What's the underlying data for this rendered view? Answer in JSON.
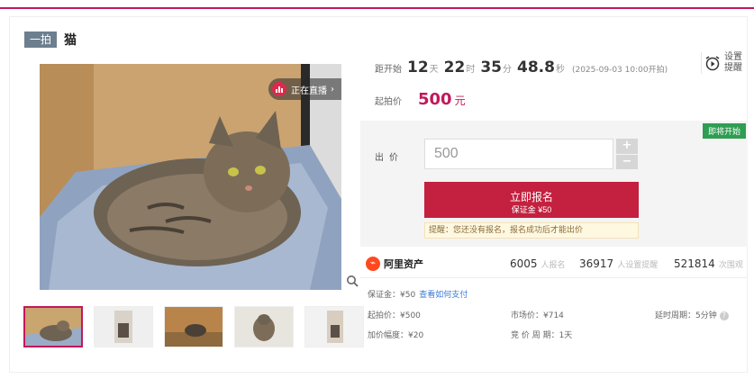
{
  "header": {
    "tag": "一拍",
    "title": "猫"
  },
  "live": {
    "label": "正在直播"
  },
  "countdown": {
    "label": "距开始",
    "days": "12",
    "days_unit": "天",
    "hours": "22",
    "hours_unit": "时",
    "minutes": "35",
    "minutes_unit": "分",
    "seconds": "48.8",
    "seconds_unit": "秒",
    "start_date": "(2025-09-03 10:00开拍)"
  },
  "remind": {
    "label": "设置提醒"
  },
  "start_price": {
    "label": "起拍价",
    "value": "500",
    "unit": "元"
  },
  "bid": {
    "coming_badge": "即将开始",
    "label": "出价",
    "input_value": "500",
    "plus": "+",
    "minus": "−",
    "signup_label": "立即报名",
    "deposit_label": "保证金 ¥50",
    "hint": "提醒：您还没有报名，报名成功后才能出价"
  },
  "org": {
    "name": "阿里资产",
    "stats": [
      {
        "value": "6005",
        "label": "人报名"
      },
      {
        "value": "36917",
        "label": "人设置提醒"
      },
      {
        "value": "521814",
        "label": "次围观"
      }
    ]
  },
  "details": {
    "deposit": "保证金：¥50",
    "how_to_pay": "查看如何支付",
    "start_price": "起拍价：¥500",
    "market_price": "市场价：¥714",
    "cycle": "延时周期：5分钟",
    "increment": "加价幅度：¥20",
    "period": "竞 价 周 期：1天"
  },
  "colors": {
    "accent": "#c2185b",
    "signup": "#c4203f",
    "coming": "#2e9e52",
    "tag": "#6d7f8f"
  },
  "icons": [
    "live-chart-icon",
    "zoom-icon",
    "alarm-clock-icon",
    "org-logo-icon",
    "question-icon"
  ]
}
